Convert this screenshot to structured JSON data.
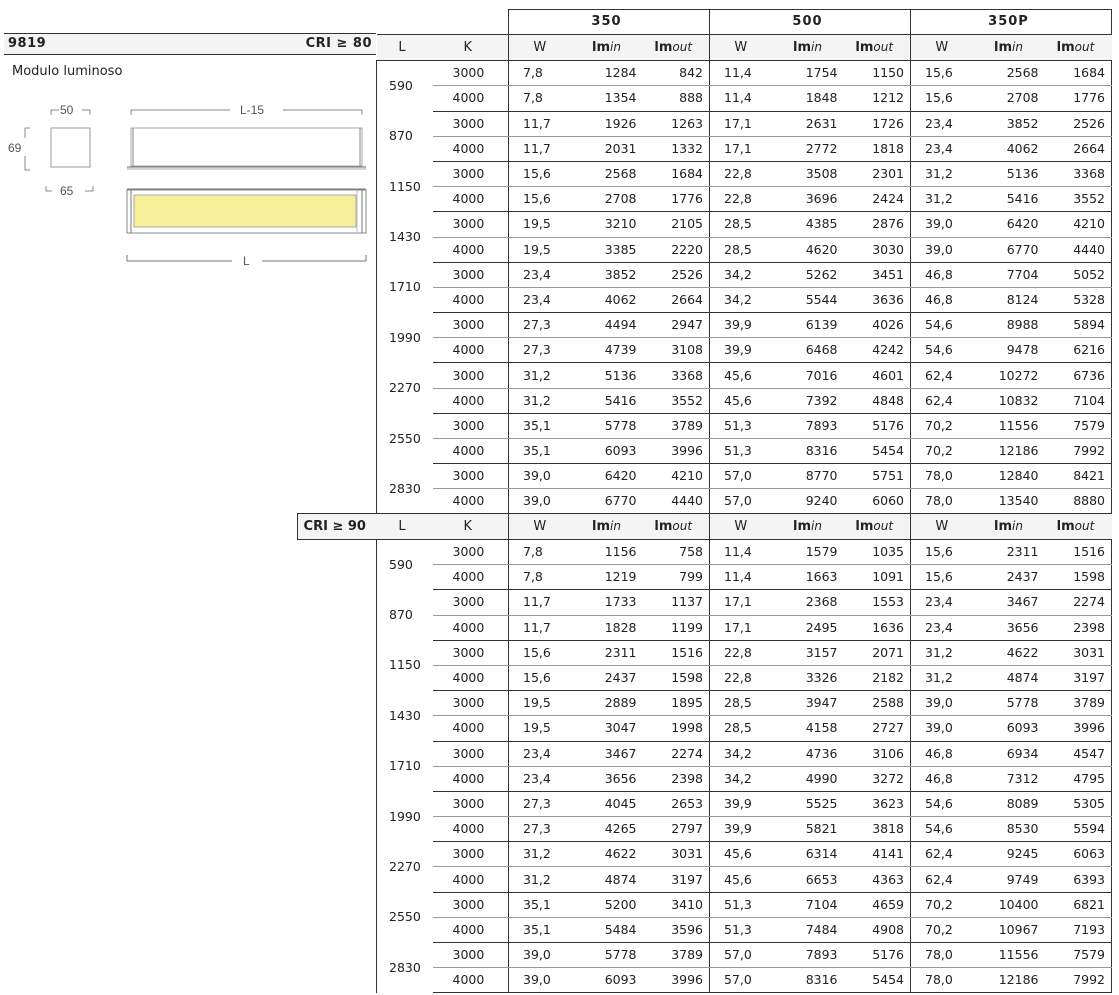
{
  "product": {
    "code": "9819",
    "subtitle": "Modulo luminoso"
  },
  "drawing": {
    "dim_width": "50",
    "dim_height": "69",
    "dim_depth": "65",
    "dim_length_inner": "L-15",
    "dim_length": "L",
    "emitter_color": "#f7ee9a"
  },
  "groups": [
    "350",
    "500",
    "350P"
  ],
  "col_labels": {
    "l": "L",
    "k": "K",
    "w": "W",
    "lm": "lm",
    "in": "in",
    "out": "out"
  },
  "tables": [
    {
      "cri": "CRI ≥ 80",
      "rows": [
        {
          "l": "590",
          "k": [
            "3000",
            "4000"
          ],
          "v": [
            [
              "7,8",
              "1284",
              "842",
              "11,4",
              "1754",
              "1150",
              "15,6",
              "2568",
              "1684"
            ],
            [
              "7,8",
              "1354",
              "888",
              "11,4",
              "1848",
              "1212",
              "15,6",
              "2708",
              "1776"
            ]
          ]
        },
        {
          "l": "870",
          "k": [
            "3000",
            "4000"
          ],
          "v": [
            [
              "11,7",
              "1926",
              "1263",
              "17,1",
              "2631",
              "1726",
              "23,4",
              "3852",
              "2526"
            ],
            [
              "11,7",
              "2031",
              "1332",
              "17,1",
              "2772",
              "1818",
              "23,4",
              "4062",
              "2664"
            ]
          ]
        },
        {
          "l": "1150",
          "k": [
            "3000",
            "4000"
          ],
          "v": [
            [
              "15,6",
              "2568",
              "1684",
              "22,8",
              "3508",
              "2301",
              "31,2",
              "5136",
              "3368"
            ],
            [
              "15,6",
              "2708",
              "1776",
              "22,8",
              "3696",
              "2424",
              "31,2",
              "5416",
              "3552"
            ]
          ]
        },
        {
          "l": "1430",
          "k": [
            "3000",
            "4000"
          ],
          "v": [
            [
              "19,5",
              "3210",
              "2105",
              "28,5",
              "4385",
              "2876",
              "39,0",
              "6420",
              "4210"
            ],
            [
              "19,5",
              "3385",
              "2220",
              "28,5",
              "4620",
              "3030",
              "39,0",
              "6770",
              "4440"
            ]
          ]
        },
        {
          "l": "1710",
          "k": [
            "3000",
            "4000"
          ],
          "v": [
            [
              "23,4",
              "3852",
              "2526",
              "34,2",
              "5262",
              "3451",
              "46,8",
              "7704",
              "5052"
            ],
            [
              "23,4",
              "4062",
              "2664",
              "34,2",
              "5544",
              "3636",
              "46,8",
              "8124",
              "5328"
            ]
          ]
        },
        {
          "l": "1990",
          "k": [
            "3000",
            "4000"
          ],
          "v": [
            [
              "27,3",
              "4494",
              "2947",
              "39,9",
              "6139",
              "4026",
              "54,6",
              "8988",
              "5894"
            ],
            [
              "27,3",
              "4739",
              "3108",
              "39,9",
              "6468",
              "4242",
              "54,6",
              "9478",
              "6216"
            ]
          ]
        },
        {
          "l": "2270",
          "k": [
            "3000",
            "4000"
          ],
          "v": [
            [
              "31,2",
              "5136",
              "3368",
              "45,6",
              "7016",
              "4601",
              "62,4",
              "10272",
              "6736"
            ],
            [
              "31,2",
              "5416",
              "3552",
              "45,6",
              "7392",
              "4848",
              "62,4",
              "10832",
              "7104"
            ]
          ]
        },
        {
          "l": "2550",
          "k": [
            "3000",
            "4000"
          ],
          "v": [
            [
              "35,1",
              "5778",
              "3789",
              "51,3",
              "7893",
              "5176",
              "70,2",
              "11556",
              "7579"
            ],
            [
              "35,1",
              "6093",
              "3996",
              "51,3",
              "8316",
              "5454",
              "70,2",
              "12186",
              "7992"
            ]
          ]
        },
        {
          "l": "2830",
          "k": [
            "3000",
            "4000"
          ],
          "v": [
            [
              "39,0",
              "6420",
              "4210",
              "57,0",
              "8770",
              "5751",
              "78,0",
              "12840",
              "8421"
            ],
            [
              "39,0",
              "6770",
              "4440",
              "57,0",
              "9240",
              "6060",
              "78,0",
              "13540",
              "8880"
            ]
          ]
        }
      ]
    },
    {
      "cri": "CRI ≥ 90",
      "rows": [
        {
          "l": "590",
          "k": [
            "3000",
            "4000"
          ],
          "v": [
            [
              "7,8",
              "1156",
              "758",
              "11,4",
              "1579",
              "1035",
              "15,6",
              "2311",
              "1516"
            ],
            [
              "7,8",
              "1219",
              "799",
              "11,4",
              "1663",
              "1091",
              "15,6",
              "2437",
              "1598"
            ]
          ]
        },
        {
          "l": "870",
          "k": [
            "3000",
            "4000"
          ],
          "v": [
            [
              "11,7",
              "1733",
              "1137",
              "17,1",
              "2368",
              "1553",
              "23,4",
              "3467",
              "2274"
            ],
            [
              "11,7",
              "1828",
              "1199",
              "17,1",
              "2495",
              "1636",
              "23,4",
              "3656",
              "2398"
            ]
          ]
        },
        {
          "l": "1150",
          "k": [
            "3000",
            "4000"
          ],
          "v": [
            [
              "15,6",
              "2311",
              "1516",
              "22,8",
              "3157",
              "2071",
              "31,2",
              "4622",
              "3031"
            ],
            [
              "15,6",
              "2437",
              "1598",
              "22,8",
              "3326",
              "2182",
              "31,2",
              "4874",
              "3197"
            ]
          ]
        },
        {
          "l": "1430",
          "k": [
            "3000",
            "4000"
          ],
          "v": [
            [
              "19,5",
              "2889",
              "1895",
              "28,5",
              "3947",
              "2588",
              "39,0",
              "5778",
              "3789"
            ],
            [
              "19,5",
              "3047",
              "1998",
              "28,5",
              "4158",
              "2727",
              "39,0",
              "6093",
              "3996"
            ]
          ]
        },
        {
          "l": "1710",
          "k": [
            "3000",
            "4000"
          ],
          "v": [
            [
              "23,4",
              "3467",
              "2274",
              "34,2",
              "4736",
              "3106",
              "46,8",
              "6934",
              "4547"
            ],
            [
              "23,4",
              "3656",
              "2398",
              "34,2",
              "4990",
              "3272",
              "46,8",
              "7312",
              "4795"
            ]
          ]
        },
        {
          "l": "1990",
          "k": [
            "3000",
            "4000"
          ],
          "v": [
            [
              "27,3",
              "4045",
              "2653",
              "39,9",
              "5525",
              "3623",
              "54,6",
              "8089",
              "5305"
            ],
            [
              "27,3",
              "4265",
              "2797",
              "39,9",
              "5821",
              "3818",
              "54,6",
              "8530",
              "5594"
            ]
          ]
        },
        {
          "l": "2270",
          "k": [
            "3000",
            "4000"
          ],
          "v": [
            [
              "31,2",
              "4622",
              "3031",
              "45,6",
              "6314",
              "4141",
              "62,4",
              "9245",
              "6063"
            ],
            [
              "31,2",
              "4874",
              "3197",
              "45,6",
              "6653",
              "4363",
              "62,4",
              "9749",
              "6393"
            ]
          ]
        },
        {
          "l": "2550",
          "k": [
            "3000",
            "4000"
          ],
          "v": [
            [
              "35,1",
              "5200",
              "3410",
              "51,3",
              "7104",
              "4659",
              "70,2",
              "10400",
              "6821"
            ],
            [
              "35,1",
              "5484",
              "3596",
              "51,3",
              "7484",
              "4908",
              "70,2",
              "10967",
              "7193"
            ]
          ]
        },
        {
          "l": "2830",
          "k": [
            "3000",
            "4000"
          ],
          "v": [
            [
              "39,0",
              "5778",
              "3789",
              "57,0",
              "7893",
              "5176",
              "78,0",
              "11556",
              "7579"
            ],
            [
              "39,0",
              "6093",
              "3996",
              "57,0",
              "8316",
              "5454",
              "78,0",
              "12186",
              "7992"
            ]
          ]
        }
      ]
    }
  ]
}
